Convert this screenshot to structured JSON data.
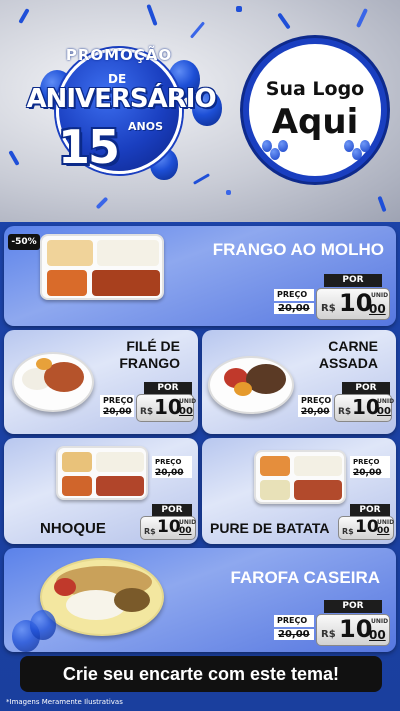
{
  "header": {
    "promo_word": "PROMOÇÃO",
    "de_word": "DE",
    "anniversary_word": "ANIVERSÁRIO",
    "years_number": "15",
    "years_word": "ANOS",
    "logo_line1": "Sua Logo",
    "logo_line2": "Aqui"
  },
  "discount_badge": "-50%",
  "products": [
    {
      "name": "FRANGO AO MOLHO",
      "preco_label": "PREÇO",
      "old_price": "20,00",
      "por_label": "POR",
      "currency": "R$",
      "price_int": "10",
      "price_cents": "00",
      "unit": "UNID"
    },
    {
      "name_l1": "FILÉ DE",
      "name_l2": "FRANGO",
      "preco_label": "PREÇO",
      "old_price": "20,00",
      "por_label": "POR",
      "currency": "R$",
      "price_int": "10",
      "price_cents": "00",
      "unit": "UNID"
    },
    {
      "name_l1": "CARNE",
      "name_l2": "ASSADA",
      "preco_label": "PREÇO",
      "old_price": "20,00",
      "por_label": "POR",
      "currency": "R$",
      "price_int": "10",
      "price_cents": "00",
      "unit": "UNID"
    },
    {
      "name": "NHOQUE",
      "preco_label": "PREÇO",
      "old_price": "20,00",
      "por_label": "POR",
      "currency": "R$",
      "price_int": "10",
      "price_cents": "00",
      "unit": "UNID"
    },
    {
      "name": "PURE DE BATATA",
      "preco_label": "PREÇO",
      "old_price": "20,00",
      "por_label": "POR",
      "currency": "R$",
      "price_int": "10",
      "price_cents": "00",
      "unit": "UNID"
    },
    {
      "name": "FAROFA CASEIRA",
      "preco_label": "PREÇO",
      "old_price": "20,00",
      "por_label": "POR",
      "currency": "R$",
      "price_int": "10",
      "price_cents": "00",
      "unit": "UNID"
    }
  ],
  "cta": "Crie seu encarte com este tema!",
  "footnote": "*Imagens Meramente Ilustrativas",
  "colors": {
    "brand_blue": "#1a3fc0",
    "dark": "#111111",
    "white": "#ffffff"
  }
}
